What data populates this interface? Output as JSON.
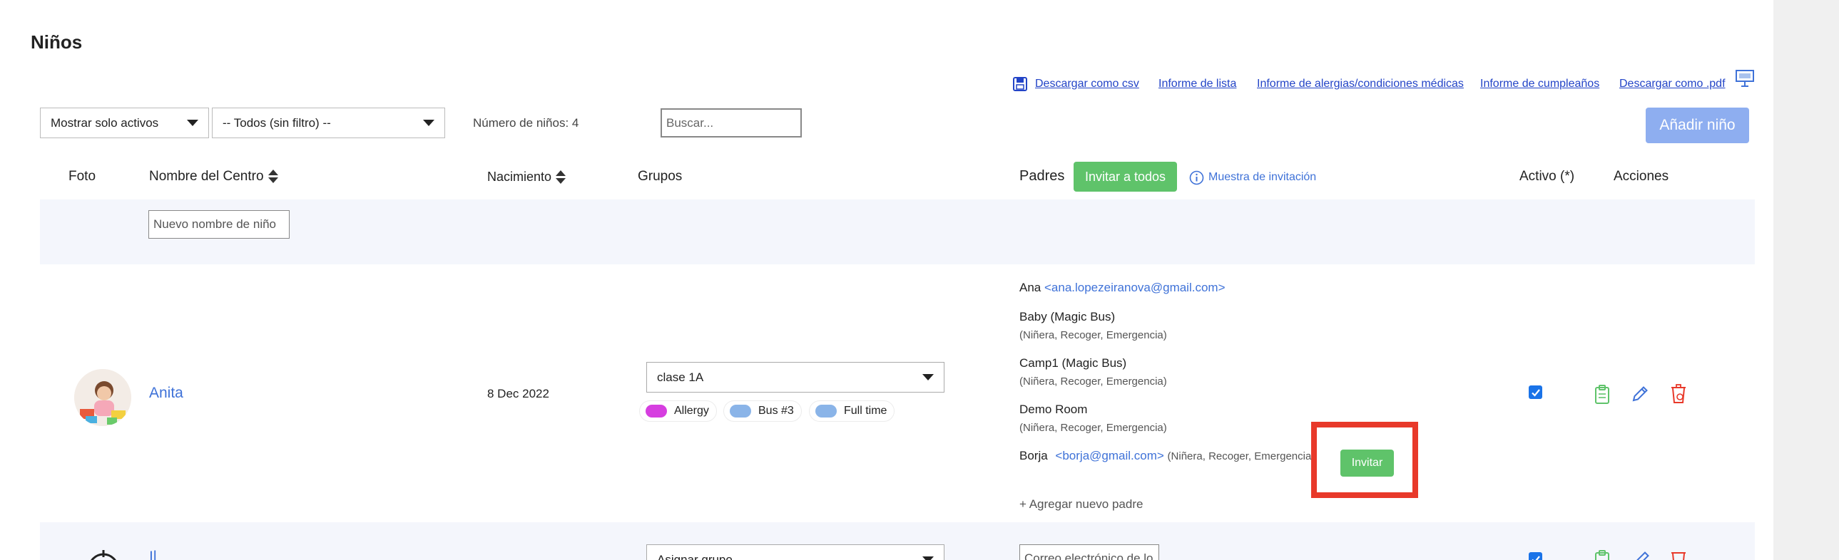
{
  "page": {
    "title": "Niños"
  },
  "toolbar_links": {
    "csv": "Descargar como csv",
    "list_report": "Informe de lista",
    "allergy_report": "Informe de alergias/condiciones médicas",
    "birthday_report": "Informe de cumpleaños",
    "pdf": "Descargar como .pdf"
  },
  "filters": {
    "active_filter": "Mostrar solo activos",
    "group_filter": "-- Todos (sin filtro) --",
    "count_label": "Número de niños: 4",
    "search_placeholder": "Buscar...",
    "add_child_label": "Añadir niño"
  },
  "table": {
    "headers": {
      "photo": "Foto",
      "name": "Nombre del Centro",
      "birth": "Nacimiento",
      "groups": "Grupos",
      "parents": "Padres",
      "invite_all": "Invitar a todos",
      "invite_sample": "Muestra de invitación",
      "active": "Activo (*)",
      "actions": "Acciones"
    },
    "new_row": {
      "name_placeholder": "Nuevo nombre de niño"
    },
    "rows": [
      {
        "name": "Anita",
        "birth": "8 Dec 2022",
        "group": "clase 1A",
        "tags": [
          {
            "label": "Allergy",
            "color": "#d63ee0"
          },
          {
            "label": "Bus #3",
            "color": "#8ab4e8"
          },
          {
            "label": "Full time",
            "color": "#8ab4e8"
          }
        ],
        "parents": [
          {
            "name": "Ana",
            "email": "<ana.lopezeiranova@gmail.com>",
            "roles": ""
          },
          {
            "name": "Baby (Magic Bus)",
            "email": "",
            "roles": "(Niñera, Recoger, Emergencia)"
          },
          {
            "name": "Camp1 (Magic Bus)",
            "email": "",
            "roles": "(Niñera, Recoger, Emergencia)"
          },
          {
            "name": "Demo Room",
            "email": "",
            "roles": "(Niñera, Recoger, Emergencia)"
          },
          {
            "name": "Borja",
            "email": "<borja@gmail.com>",
            "roles": "(Niñera, Recoger, Emergencia)"
          }
        ],
        "invite_label": "Invitar",
        "add_parent": "+ Agregar nuevo padre",
        "active": true
      },
      {
        "name": "Il",
        "group": "Asignar grupo",
        "email_placeholder": "Correo electrónico de lo",
        "active": true
      }
    ]
  },
  "colors": {
    "accent_blue": "#3f72d8",
    "green": "#5fc36a",
    "highlight": "#e8392a",
    "add_button": "#8eaef0"
  }
}
